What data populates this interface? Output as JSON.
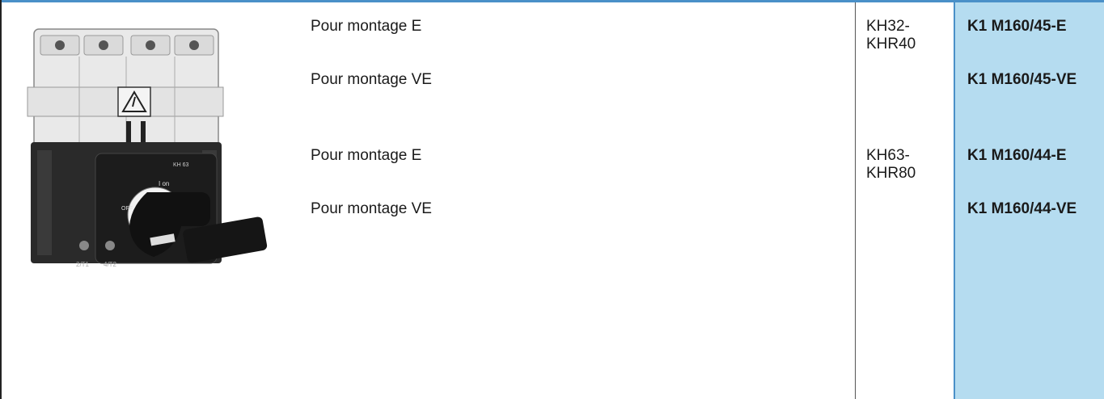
{
  "colors": {
    "top_border": "#4a90c8",
    "code_column_bg": "#b5dcf0",
    "text": "#1a1a1a"
  },
  "product_image": {
    "icon": "disconnect-switch-product-photo",
    "labels": {
      "term_left": "2/T1",
      "term_right": "4/T2",
      "on": "I on",
      "off": "OFF",
      "model": "KH 63"
    }
  },
  "rows": [
    {
      "description": "Pour montage E",
      "reference": [
        "KH32-",
        "KHR40"
      ],
      "code": "K1 M160/45-E"
    },
    {
      "description": "Pour montage VE",
      "reference": [],
      "code": "K1 M160/45-VE"
    },
    {
      "description": "Pour montage E",
      "reference": [
        "KH63-",
        "KHR80"
      ],
      "code": "K1 M160/44-E"
    },
    {
      "description": "Pour montage VE",
      "reference": [],
      "code": "K1 M160/44-VE"
    }
  ]
}
